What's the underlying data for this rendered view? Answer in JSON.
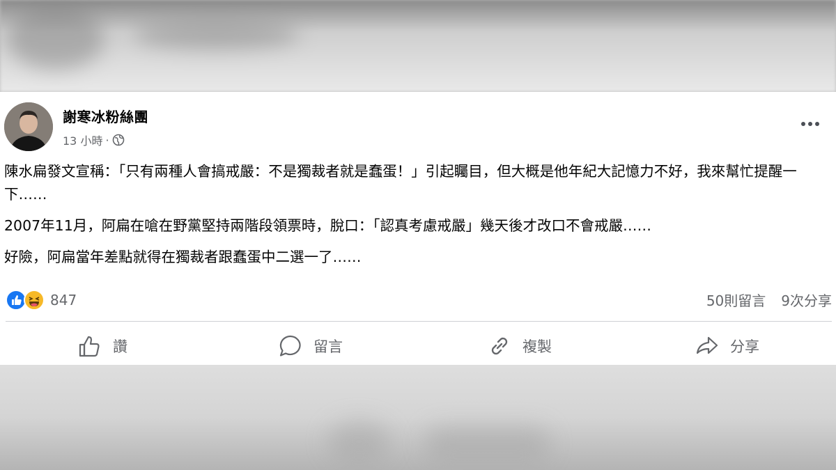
{
  "post": {
    "author": "謝寒冰粉絲團",
    "time": "13 小時",
    "separator": "·",
    "privacy_icon": "globe-icon",
    "more_icon": "more-options-icon",
    "paragraphs": [
      "陳水扁發文宣稱：「只有兩種人會搞戒嚴：不是獨裁者就是蠢蛋！」引起矚目，但大概是他年紀大記憶力不好，我來幫忙提醒一下……",
      "2007年11月，阿扁在嗆在野黨堅持兩階段領票時，脫口：「認真考慮戒嚴」幾天後才改口不會戒嚴……",
      "好險，阿扁當年差點就得在獨裁者跟蠢蛋中二選一了……"
    ],
    "reactions": {
      "icons": [
        "like-reaction-icon",
        "haha-reaction-icon"
      ],
      "count": "847"
    },
    "comments_count": "50則留言",
    "shares_count": "9次分享",
    "actions": {
      "like": "讚",
      "comment": "留言",
      "copy": "複製",
      "share": "分享"
    }
  },
  "colors": {
    "text": "#050505",
    "secondary": "#65676b",
    "like_blue": "#1877f2",
    "haha_yellow": "#f7b928",
    "divider": "#ced0d4"
  }
}
